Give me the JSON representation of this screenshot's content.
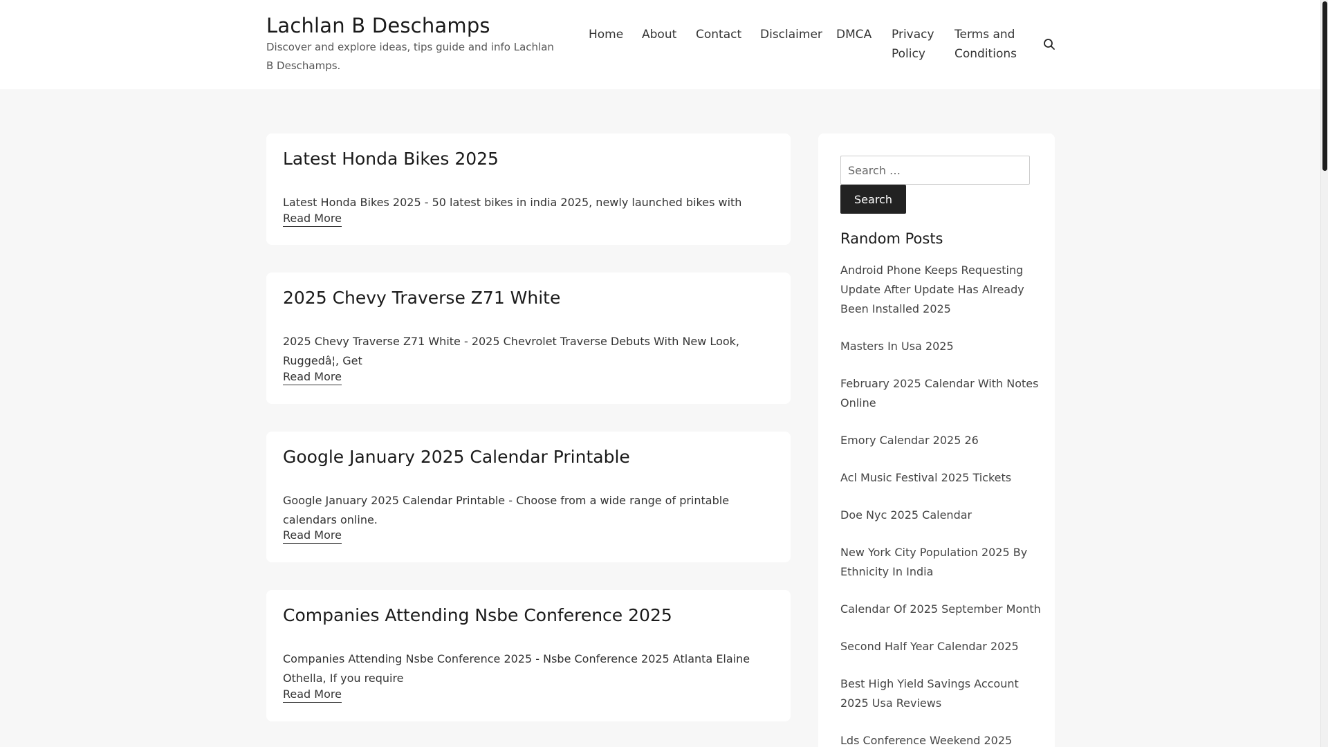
{
  "site": {
    "title": "Lachlan B Deschamps",
    "description": "Discover and explore ideas, tips guide and info Lachlan B Deschamps."
  },
  "nav": {
    "items": [
      {
        "label": "Home"
      },
      {
        "label": "About"
      },
      {
        "label": "Contact"
      },
      {
        "label": "Disclaimer"
      },
      {
        "label": "DMCA"
      },
      {
        "label": "Privacy Policy"
      },
      {
        "label": "Terms and Conditions"
      }
    ],
    "search_icon": "search-icon"
  },
  "posts": [
    {
      "title": "Latest Honda Bikes 2025",
      "excerpt": "Latest Honda Bikes 2025 - 50 latest bikes in india 2025, newly launched bikes with",
      "read_more": "Read More"
    },
    {
      "title": "2025 Chevy Traverse Z71 White",
      "excerpt": "2025 Chevy Traverse Z71 White - 2025 Chevrolet Traverse Debuts With New Look, Ruggedâ¦, Get",
      "read_more": "Read More"
    },
    {
      "title": "Google January 2025 Calendar Printable",
      "excerpt": "Google January 2025 Calendar Printable - Choose from a wide range of printable calendars online.",
      "read_more": "Read More"
    },
    {
      "title": "Companies Attending Nsbe Conference 2025",
      "excerpt": "Companies Attending Nsbe Conference 2025 - Nsbe Conference 2025 Atlanta Elaine Othella, If you require",
      "read_more": "Read More"
    }
  ],
  "sidebar": {
    "search": {
      "placeholder": "Search …",
      "button_label": "Search"
    },
    "random_posts_title": "Random Posts",
    "random_posts": [
      "Android Phone Keeps Requesting Update After Update Has Already Been Installed 2025",
      "Masters In Usa 2025",
      "February 2025 Calendar With Notes Online",
      "Emory Calendar 2025 26",
      "Acl Music Festival 2025 Tickets",
      "Doe Nyc 2025 Calendar",
      "New York City Population 2025 By Ethnicity In India",
      "Calendar Of 2025 September Month",
      "Second Half Year Calendar 2025",
      "Best High Yield Savings Account 2025 Usa Reviews",
      "Lds Conference Weekend 2025"
    ]
  },
  "colors": {
    "background": "#f7f7f7",
    "card": "#ffffff",
    "button": "#222222",
    "text": "#222222"
  }
}
